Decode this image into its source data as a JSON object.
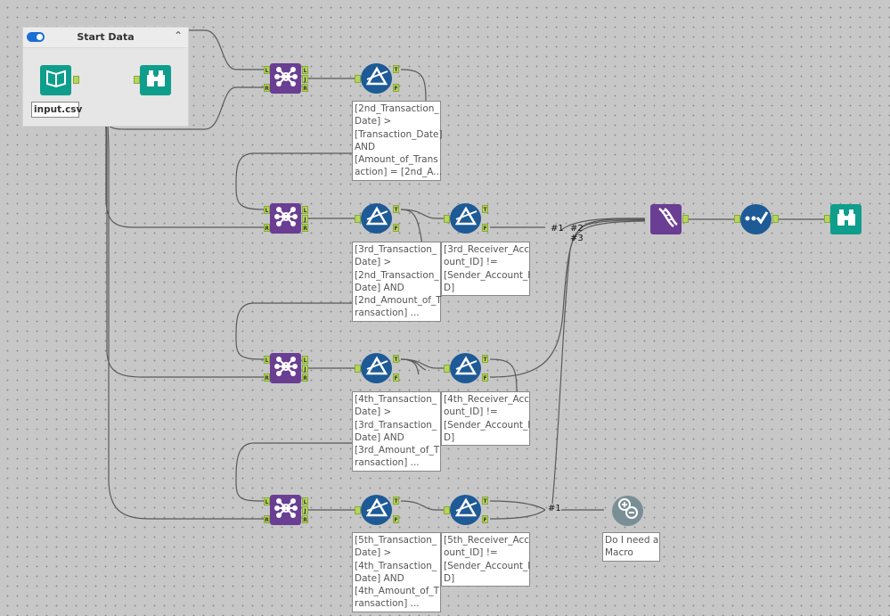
{
  "container": {
    "title": "Start Data",
    "enabled": true
  },
  "colors": {
    "canvas": "#c7c7c7",
    "input_teal": "#0f9e8c",
    "join_purple": "#6a3e92",
    "filter_blue": "#1d5a96",
    "anchor_green": "#b5d65a",
    "macro_grey": "#7a8e95"
  },
  "nodes": {
    "input": {
      "icon": "input-data-book-icon",
      "label": "input.csv"
    },
    "browse1": {
      "icon": "binoculars-icon"
    },
    "browse2": {
      "icon": "binoculars-icon"
    },
    "union": {
      "icon": "dna-union-icon"
    },
    "select": {
      "icon": "select-check-icon"
    },
    "macro": {
      "icon": "plus-minus-macro-icon",
      "label": [
        "Do I need a",
        "Macro"
      ]
    },
    "joins": [
      {
        "anchors_in": [
          "L",
          "R"
        ],
        "anchors_out": [
          "L",
          "J",
          "R"
        ]
      },
      {
        "anchors_in": [
          "L",
          "R"
        ],
        "anchors_out": [
          "L",
          "J",
          "R"
        ]
      },
      {
        "anchors_in": [
          "L",
          "R"
        ],
        "anchors_out": [
          "L",
          "J",
          "R"
        ]
      },
      {
        "anchors_in": [
          "L",
          "R"
        ],
        "anchors_out": [
          "L",
          "J",
          "R"
        ]
      }
    ],
    "filters_date": [
      {
        "anchors_out": [
          "T",
          "F"
        ],
        "label": [
          "[2nd_Transaction_",
          "Date] >",
          "[Transaction_Date]",
          "AND",
          "[Amount_of_Trans",
          "action] = [2nd_A..."
        ]
      },
      {
        "anchors_out": [
          "T",
          "F"
        ],
        "label": [
          "[3rd_Transaction_",
          "Date] >",
          "[2nd_Transaction_",
          "Date] AND",
          "[2nd_Amount_of_T",
          "ransaction] ..."
        ]
      },
      {
        "anchors_out": [
          "T",
          "F"
        ],
        "label": [
          "[4th_Transaction_",
          "Date] >",
          "[3rd_Transaction_",
          "Date] AND",
          "[3rd_Amount_of_T",
          "ransaction] ..."
        ]
      },
      {
        "anchors_out": [
          "T",
          "F"
        ],
        "label": [
          "[5th_Transaction_",
          "Date] >",
          "[4th_Transaction_",
          "Date] AND",
          "[4th_Amount_of_T",
          "ransaction] ..."
        ]
      }
    ],
    "filters_account": [
      {
        "anchors_out": [
          "T",
          "F"
        ],
        "label": [
          "[3rd_Receiver_Acc",
          "ount_ID] !=",
          "[Sender_Account_I",
          "D]"
        ]
      },
      {
        "anchors_out": [
          "T",
          "F"
        ],
        "label": [
          "[4th_Receiver_Acc",
          "ount_ID] !=",
          "[Sender_Account_I",
          "D]"
        ]
      },
      {
        "anchors_out": [
          "T",
          "F"
        ],
        "label": [
          "[5th_Receiver_Acc",
          "ount_ID] !=",
          "[Sender_Account_I",
          "D]"
        ]
      }
    ]
  },
  "connection_labels": {
    "union_1": "#1",
    "union_2": "#2",
    "union_3": "#3",
    "macro_1": "#1"
  }
}
